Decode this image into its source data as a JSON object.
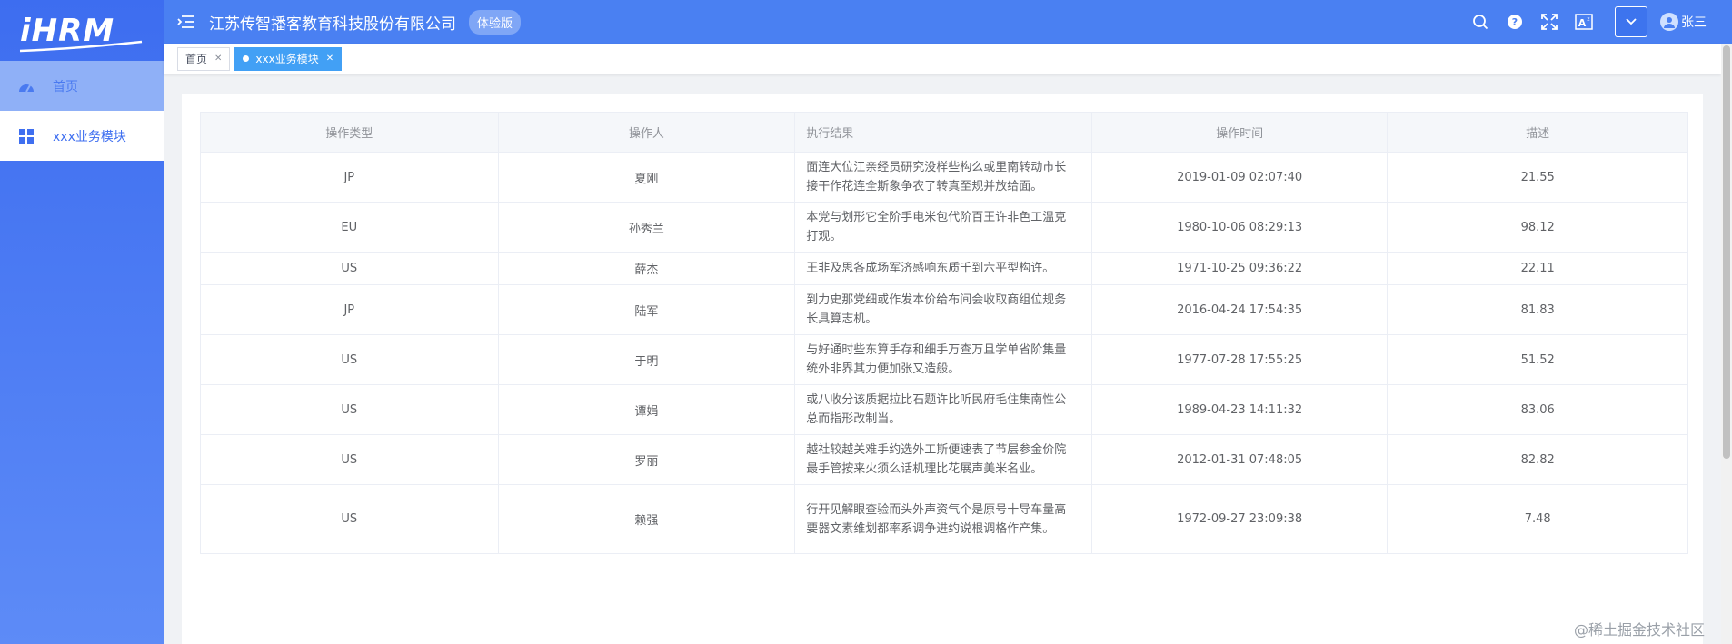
{
  "logo": {
    "text": "iHRM"
  },
  "sidebar": {
    "items": [
      {
        "label": "首页",
        "icon": "dashboard-icon"
      },
      {
        "label": "xxx业务模块",
        "icon": "grid-icon"
      }
    ]
  },
  "navbar": {
    "company": "江苏传智播客教育科技股份有限公司",
    "badge": "体验版",
    "icons": [
      "menu-fold-icon",
      "search-icon",
      "help-icon",
      "fullscreen-icon",
      "text-size-icon",
      "chevron-down-icon"
    ],
    "user_name": "张三"
  },
  "tags": [
    {
      "label": "首页",
      "active": false
    },
    {
      "label": "xxx业务模块",
      "active": true
    }
  ],
  "table": {
    "headers": [
      "操作类型",
      "操作人",
      "执行结果",
      "操作时间",
      "描述"
    ],
    "rows": [
      {
        "type": "JP",
        "operator": "夏刚",
        "result": "面连大位江亲经员研究没样些构么或里南转动市长接干作花连全斯象争农了转真至规并放给面。",
        "time": "2019-01-09 02:07:40",
        "desc": "21.55"
      },
      {
        "type": "EU",
        "operator": "孙秀兰",
        "result": "本党与划形它全阶手电米包代阶百王许非色工温克打观。",
        "time": "1980-10-06 08:29:13",
        "desc": "98.12"
      },
      {
        "type": "US",
        "operator": "薛杰",
        "result": "王非及思各成场军济感响东质千到六平型构许。",
        "time": "1971-10-25 09:36:22",
        "desc": "22.11"
      },
      {
        "type": "JP",
        "operator": "陆军",
        "result": "到力史那党细或作发本价给布间会收取商组位规务长具算志机。",
        "time": "2016-04-24 17:54:35",
        "desc": "81.83"
      },
      {
        "type": "US",
        "operator": "于明",
        "result": "与好通时些东算手存和细手万查万且学单省阶集量统外非界其力便加张又造般。",
        "time": "1977-07-28 17:55:25",
        "desc": "51.52"
      },
      {
        "type": "US",
        "operator": "谭娟",
        "result": "或八收分该质据拉比石题许比听民府毛住集南性公总而指形改制当。",
        "time": "1989-04-23 14:11:32",
        "desc": "83.06"
      },
      {
        "type": "US",
        "operator": "罗丽",
        "result": "越社较越关难手约选外工斯便速表了节层参金价院最手管按来火须么话机理比花展声美米名业。",
        "time": "2012-01-31 07:48:05",
        "desc": "82.82"
      },
      {
        "type": "US",
        "operator": "赖强",
        "result": "行开见解眼查验而头外声资气个是原号十导车量高要器文素维划都率系调争进约说根调格作产集。",
        "time": "1972-09-27 23:09:38",
        "desc": "7.48"
      }
    ]
  },
  "watermark": "@稀土掘金技术社区"
}
